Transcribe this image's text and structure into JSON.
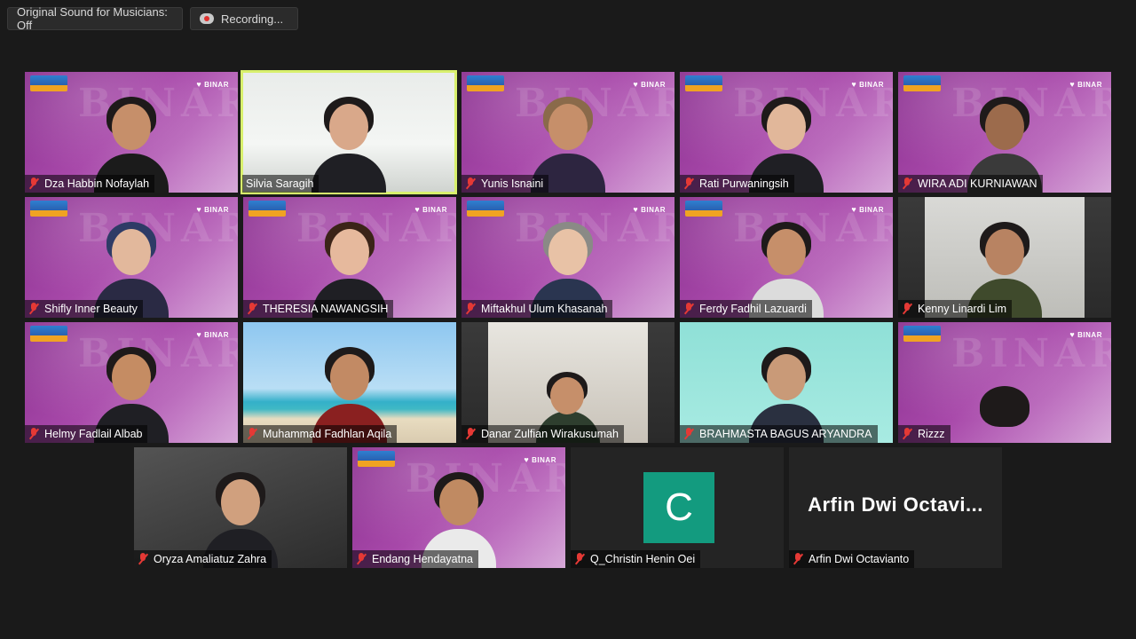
{
  "toolbar": {
    "original_sound": "Original Sound for Musicians: Off",
    "recording": "Recording..."
  },
  "brand_logo": "BINAR",
  "participants": [
    {
      "name": "Dza Habbin Nofaylah"
    },
    {
      "name": "Silvia Saragih"
    },
    {
      "name": "Yunis Isnaini"
    },
    {
      "name": "Rati Purwaningsih"
    },
    {
      "name": "WIRA ADI KURNIAWAN"
    },
    {
      "name": "Shifly Inner Beauty"
    },
    {
      "name": "THERESIA NAWANGSIH"
    },
    {
      "name": "Miftakhul Ulum Khasanah"
    },
    {
      "name": "Ferdy Fadhil Lazuardi"
    },
    {
      "name": "Kenny Linardi Lim"
    },
    {
      "name": "Helmy Fadlail Albab"
    },
    {
      "name": "Muhammad Fadhlan Aqila"
    },
    {
      "name": "Danar Zulfian Wirakusumah"
    },
    {
      "name": "BRAHMASTA BAGUS ARYANDRA"
    },
    {
      "name": "Rizzz"
    },
    {
      "name": "Oryza Amaliatuz Zahra"
    },
    {
      "name": "Endang Hendayatna"
    },
    {
      "name": "Q_Christin Henin Oei",
      "avatar_letter": "C"
    },
    {
      "name": "Arfin Dwi Octavianto",
      "display_name": "Arfin Dwi Octavi..."
    }
  ],
  "active_speaker": "Silvia Saragih",
  "colors": {
    "speaker_border": "#d8f06d",
    "muted_mic": "#e53935",
    "avatar_bg": "#139b7f"
  }
}
